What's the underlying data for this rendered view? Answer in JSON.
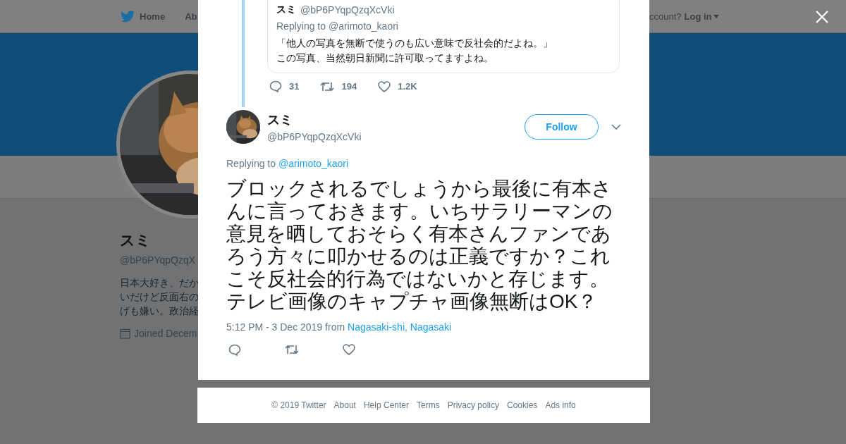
{
  "background_page": {
    "nav": {
      "items": [
        "Home",
        "Ab"
      ],
      "account_prompt": "ccount?",
      "login": "Log in"
    },
    "profile": {
      "name": "スミ",
      "handle": "@bP6PYqpQzqX",
      "bio": "日本大好き、だかいだけど反面右のげも嫌い。政治経",
      "joined": "Joined Decem"
    }
  },
  "modal": {
    "quoted_tweet": {
      "name": "スミ",
      "handle": "@bP6PYqpQzqXcVki",
      "replying_to": "Replying to @arimoto_kaori",
      "text": "「他人の写真を無断で使うのも広い意味で反社会的だよね。」この写真、当然朝日新聞に許可取ってますよね。",
      "replies": "31",
      "retweets": "194",
      "likes": "1.2K"
    },
    "tweet": {
      "name": "スミ",
      "handle": "@bP6PYqpQzqXcVki",
      "follow_button": "Follow",
      "replying_label": "Replying to",
      "replying_user": "@arimoto_kaori",
      "text": "ブロックされるでしょうから最後に有本さんに言っておきます。いちサラリーマンの意見を晒しておそらく有本さんファンであろう方々に叩かせるのは正義ですか？これこそ反社会的行為ではないかと存じます。テレビ画像のキャプチャ画像無断はOK？",
      "timestamp": "5:12 PM - 3 Dec 2019 from",
      "location": "Nagasaki-shi, Nagasaki"
    }
  },
  "footer": [
    "© 2019 Twitter",
    "About",
    "Help Center",
    "Terms",
    "Privacy policy",
    "Cookies",
    "Ads info"
  ]
}
